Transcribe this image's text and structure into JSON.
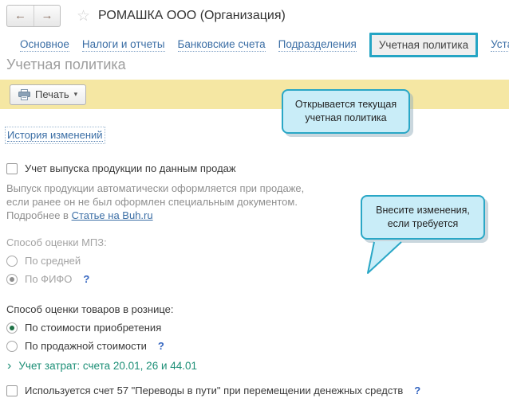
{
  "header": {
    "back_icon": "←",
    "forward_icon": "→",
    "star_icon": "☆",
    "title": "РОМАШКА ООО (Организация)"
  },
  "tabs": [
    {
      "label": "Основное",
      "active": false
    },
    {
      "label": "Налоги и отчеты",
      "active": false
    },
    {
      "label": "Банковские счета",
      "active": false
    },
    {
      "label": "Подразделения",
      "active": false
    },
    {
      "label": "Учетная политика",
      "active": true
    },
    {
      "label": "Уставный капитал",
      "active": false
    }
  ],
  "page": {
    "title": "Учетная политика"
  },
  "toolbar": {
    "print_label": "Печать",
    "caret": "▾",
    "printer_icon": "printer-icon"
  },
  "content": {
    "history_link": "История изменений",
    "production_checkbox_label": "Учет выпуска продукции по данным продаж",
    "production_checkbox_checked": false,
    "description_line1": "Выпуск продукции автоматически оформляется при продаже,",
    "description_line2": "если ранее он не был оформлен специальным документом.",
    "description_line3_prefix": "Подробнее в ",
    "description_link": "Статье на Buh.ru"
  },
  "mpz": {
    "label": "Способ оценки МПЗ:",
    "disabled": true,
    "options": [
      {
        "label": "По средней",
        "selected": false
      },
      {
        "label": "По ФИФО",
        "selected": true,
        "help": "?"
      }
    ]
  },
  "retail": {
    "label": "Способ оценки товаров в рознице:",
    "options": [
      {
        "label": "По стоимости приобретения",
        "selected": true
      },
      {
        "label": "По продажной стоимости",
        "selected": false,
        "help": "?"
      }
    ]
  },
  "costs": {
    "chevron": "›",
    "label": "Учет затрат: счета 20.01, 26 и 44.01"
  },
  "transfers": {
    "label": "Используется счет 57 \"Переводы в пути\" при перемещении денежных средств",
    "checked": false,
    "help": "?"
  },
  "callouts": [
    {
      "line1": "Открывается текущая",
      "line2": "учетная политика"
    },
    {
      "line1": "Внесите изменения,",
      "line2": "если требуется"
    }
  ],
  "colors": {
    "accent_teal": "#25A5C4",
    "toolbar_yellow": "#F5E7A3",
    "callout_bg": "#C9EDF8",
    "callout_border": "#2AA7C6",
    "link_blue": "#3B6EA5",
    "section_green": "#1D8F77",
    "radio_green": "#1E7145"
  }
}
